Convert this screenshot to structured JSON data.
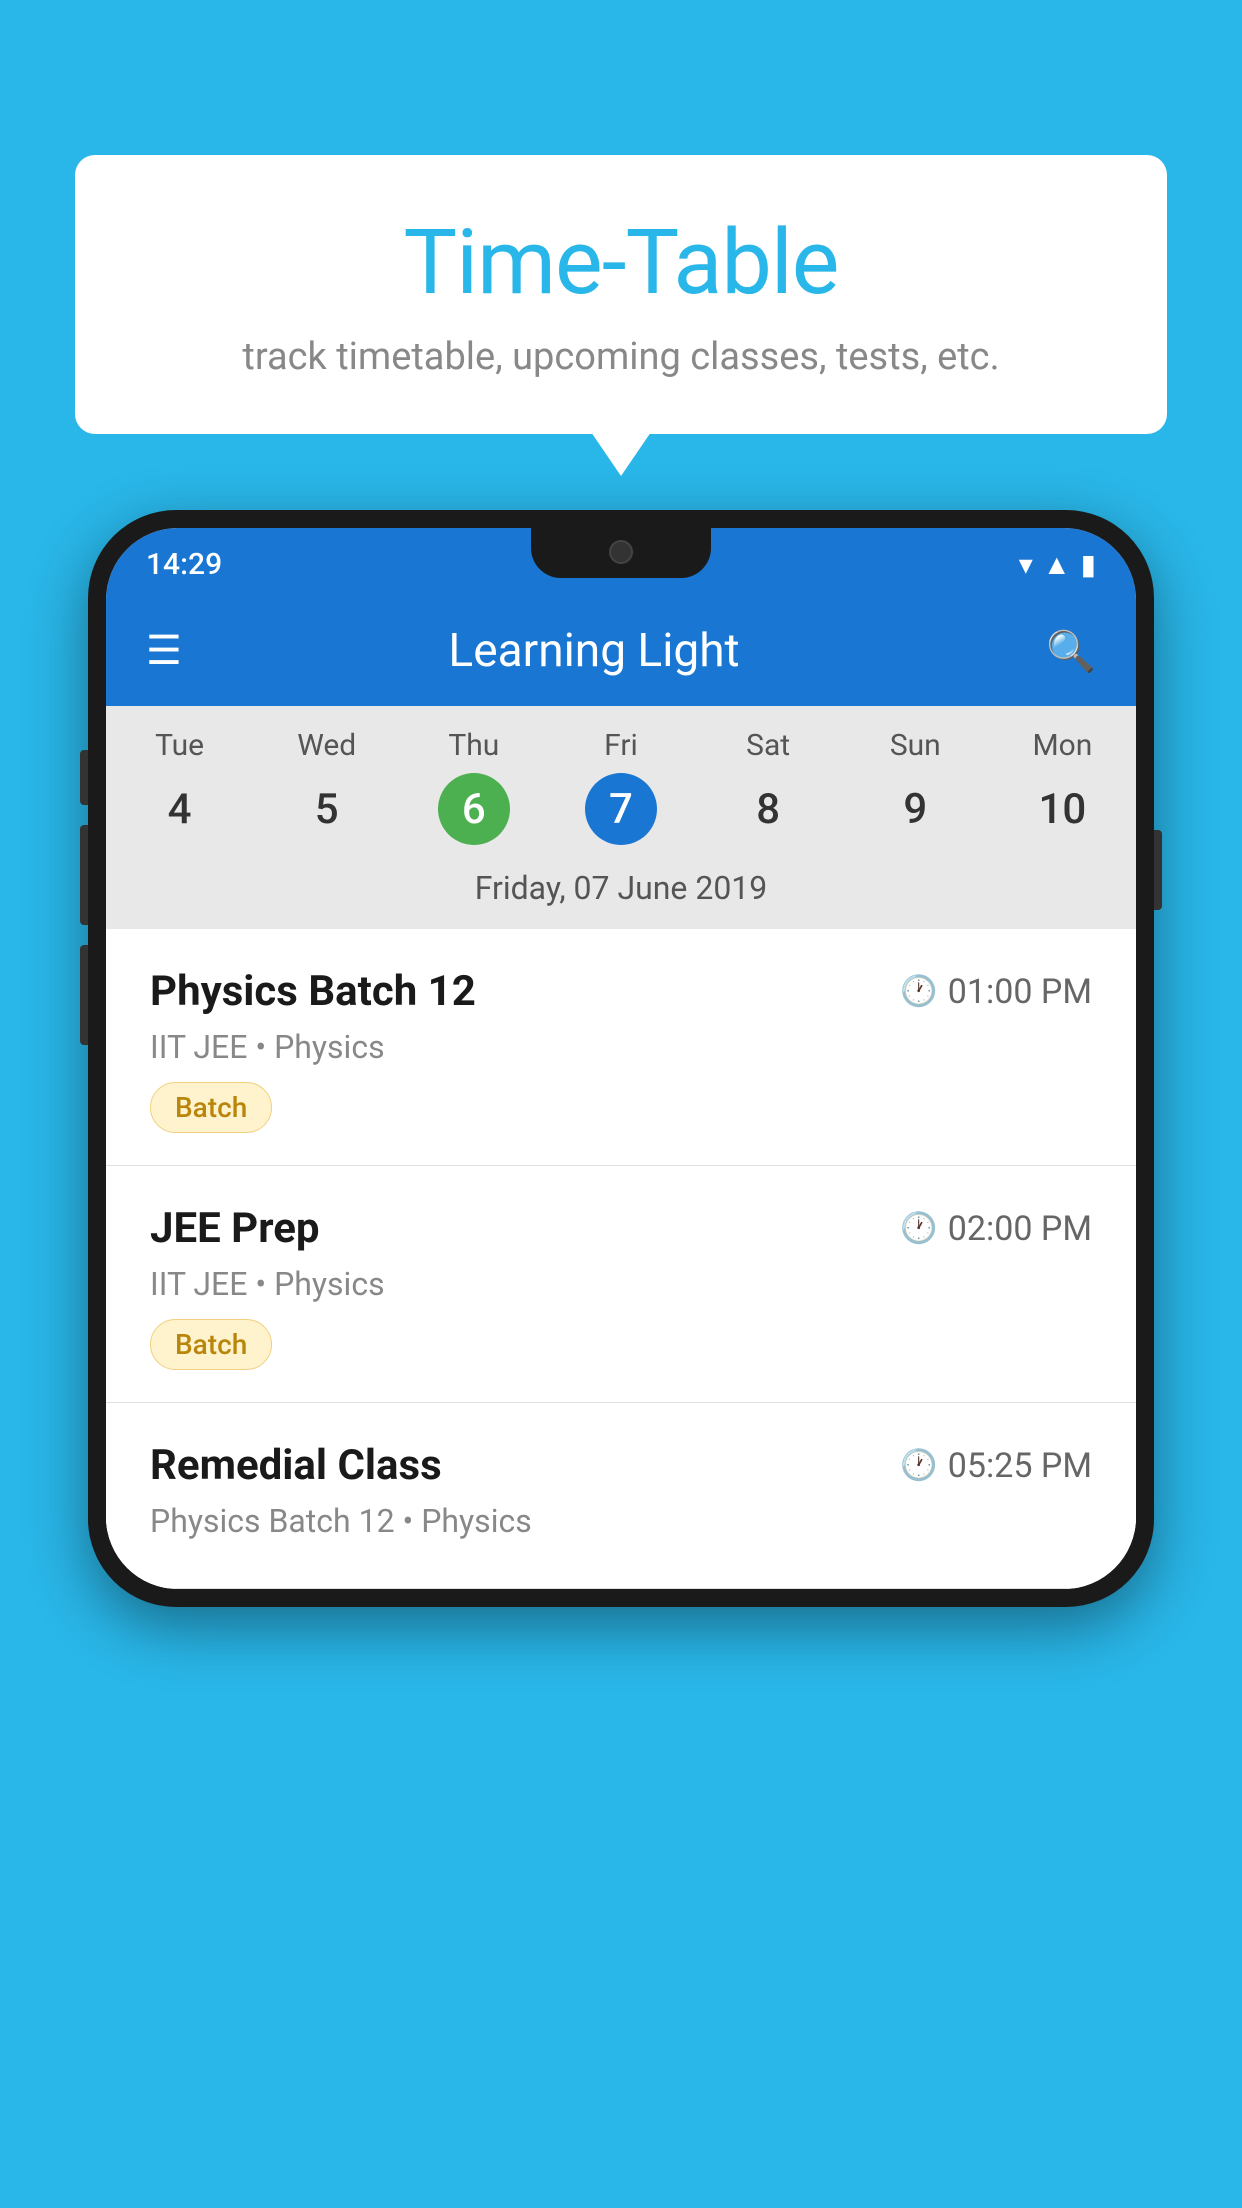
{
  "background_color": "#29B6E8",
  "bubble": {
    "title": "Time-Table",
    "subtitle": "track timetable, upcoming classes, tests, etc."
  },
  "phone": {
    "status_bar": {
      "time": "14:29"
    },
    "app_bar": {
      "title": "Learning Light"
    },
    "calendar": {
      "days": [
        {
          "name": "Tue",
          "num": "4",
          "state": "normal"
        },
        {
          "name": "Wed",
          "num": "5",
          "state": "normal"
        },
        {
          "name": "Thu",
          "num": "6",
          "state": "today"
        },
        {
          "name": "Fri",
          "num": "7",
          "state": "selected"
        },
        {
          "name": "Sat",
          "num": "8",
          "state": "normal"
        },
        {
          "name": "Sun",
          "num": "9",
          "state": "normal"
        },
        {
          "name": "Mon",
          "num": "10",
          "state": "normal"
        }
      ],
      "selected_date_label": "Friday, 07 June 2019"
    },
    "schedule": [
      {
        "title": "Physics Batch 12",
        "time": "01:00 PM",
        "subtitle": "IIT JEE • Physics",
        "badge": "Batch"
      },
      {
        "title": "JEE Prep",
        "time": "02:00 PM",
        "subtitle": "IIT JEE • Physics",
        "badge": "Batch"
      },
      {
        "title": "Remedial Class",
        "time": "05:25 PM",
        "subtitle": "Physics Batch 12 • Physics",
        "badge": null
      }
    ]
  }
}
